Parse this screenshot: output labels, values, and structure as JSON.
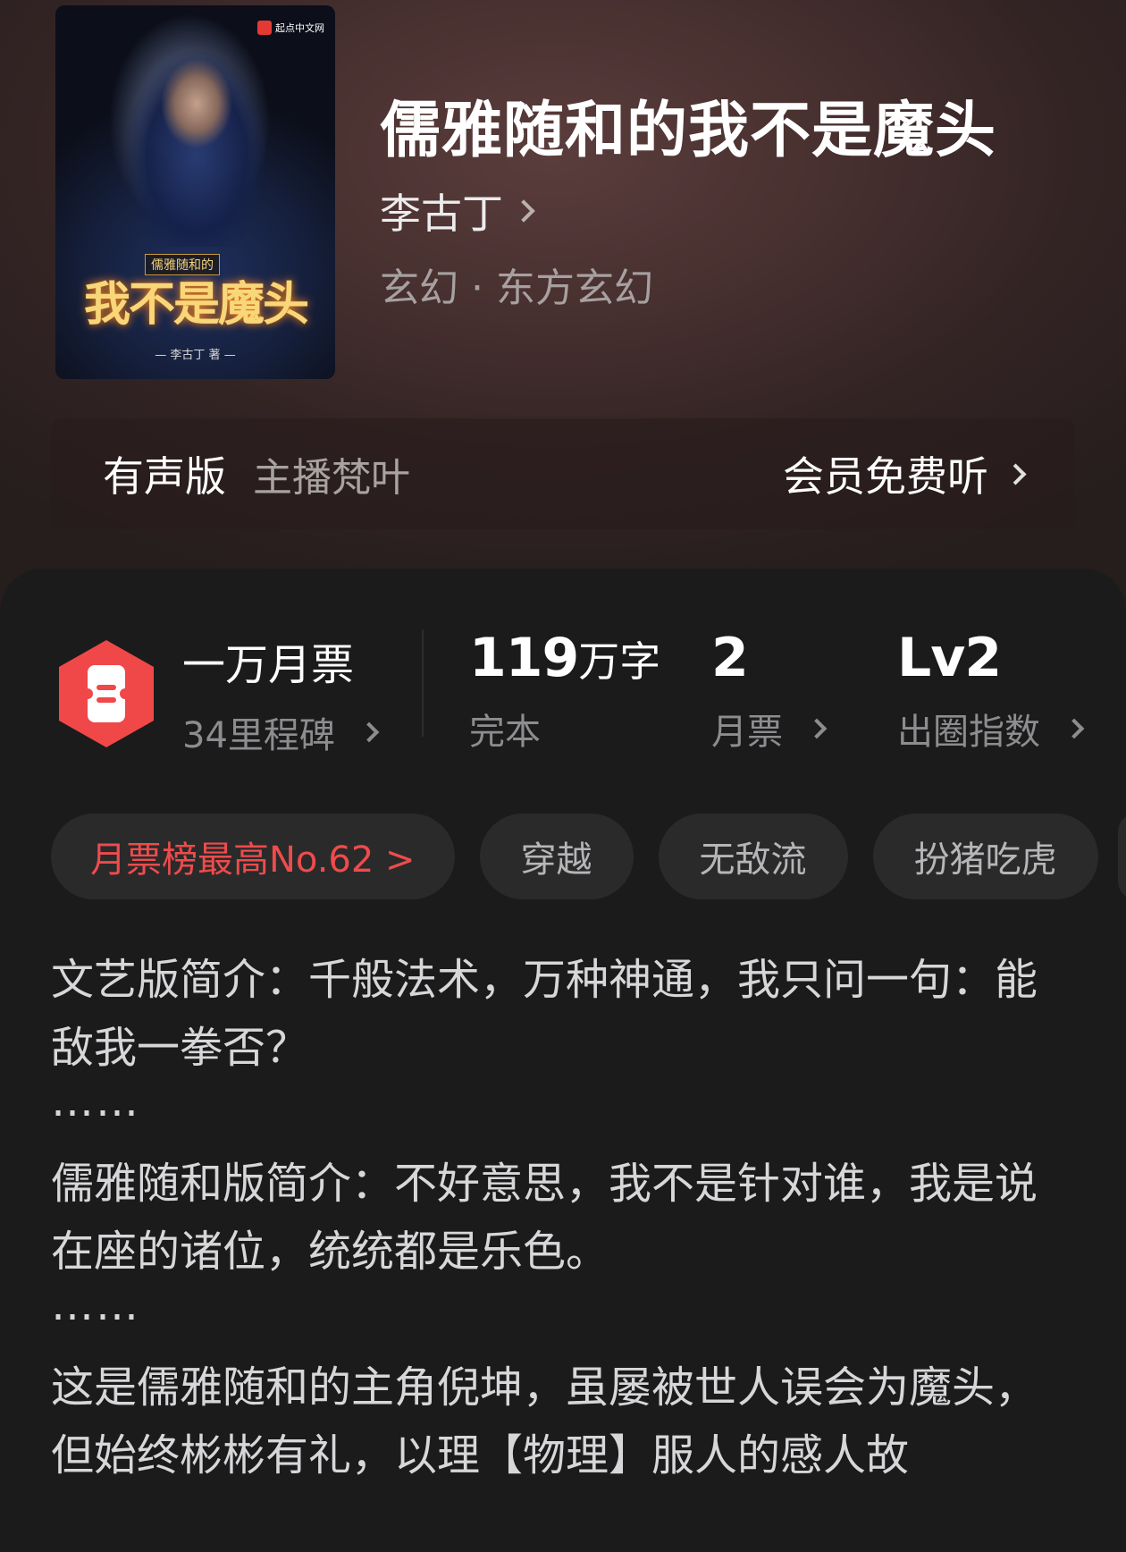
{
  "book": {
    "title": "儒雅随和的我不是魔头",
    "author": "李古丁",
    "genre": "玄幻 · 东方玄幻",
    "cover": {
      "publisher_badge": "起点中文网",
      "subtitle": "儒雅随和的",
      "title_art": "我不是魔头",
      "author_credit": "— 李古丁 著 —"
    }
  },
  "audio": {
    "label": "有声版",
    "narrator": "主播梵叶",
    "action": "会员免费听"
  },
  "stats": {
    "milestone": {
      "title": "一万月票",
      "sub": "34里程碑"
    },
    "words": {
      "number": "119",
      "unit": "万字",
      "status": "完本"
    },
    "tickets": {
      "value": "2",
      "label": "月票"
    },
    "level": {
      "value": "Lv2",
      "label": "出圈指数"
    }
  },
  "tags": {
    "rank": "月票榜最高No.62 >",
    "items": [
      "穿越",
      "无敌流",
      "扮猪吃虎"
    ]
  },
  "synopsis": {
    "p1": "文艺版简介：千般法术，万种神通，我只问一句：能敌我一拳否？",
    "dots1": "……",
    "p2": "儒雅随和版简介：不好意思，我不是针对谁，我是说在座的诸位，统统都是乐色。",
    "dots2": "……",
    "p3": "这是儒雅随和的主角倪坤，虽屡被世人误会为魔头，但始终彬彬有礼，以理【物理】服人的感人故"
  },
  "colors": {
    "accent_red": "#ef4b4b",
    "ticket_icon": "#f04848",
    "panel_bg": "#1b1b1c",
    "header_bg": "#47302f"
  },
  "icons": {
    "author_chevron": "chevron-right-icon",
    "ticket": "monthly-ticket-icon",
    "stat_chevron": "chevron-right-icon"
  }
}
